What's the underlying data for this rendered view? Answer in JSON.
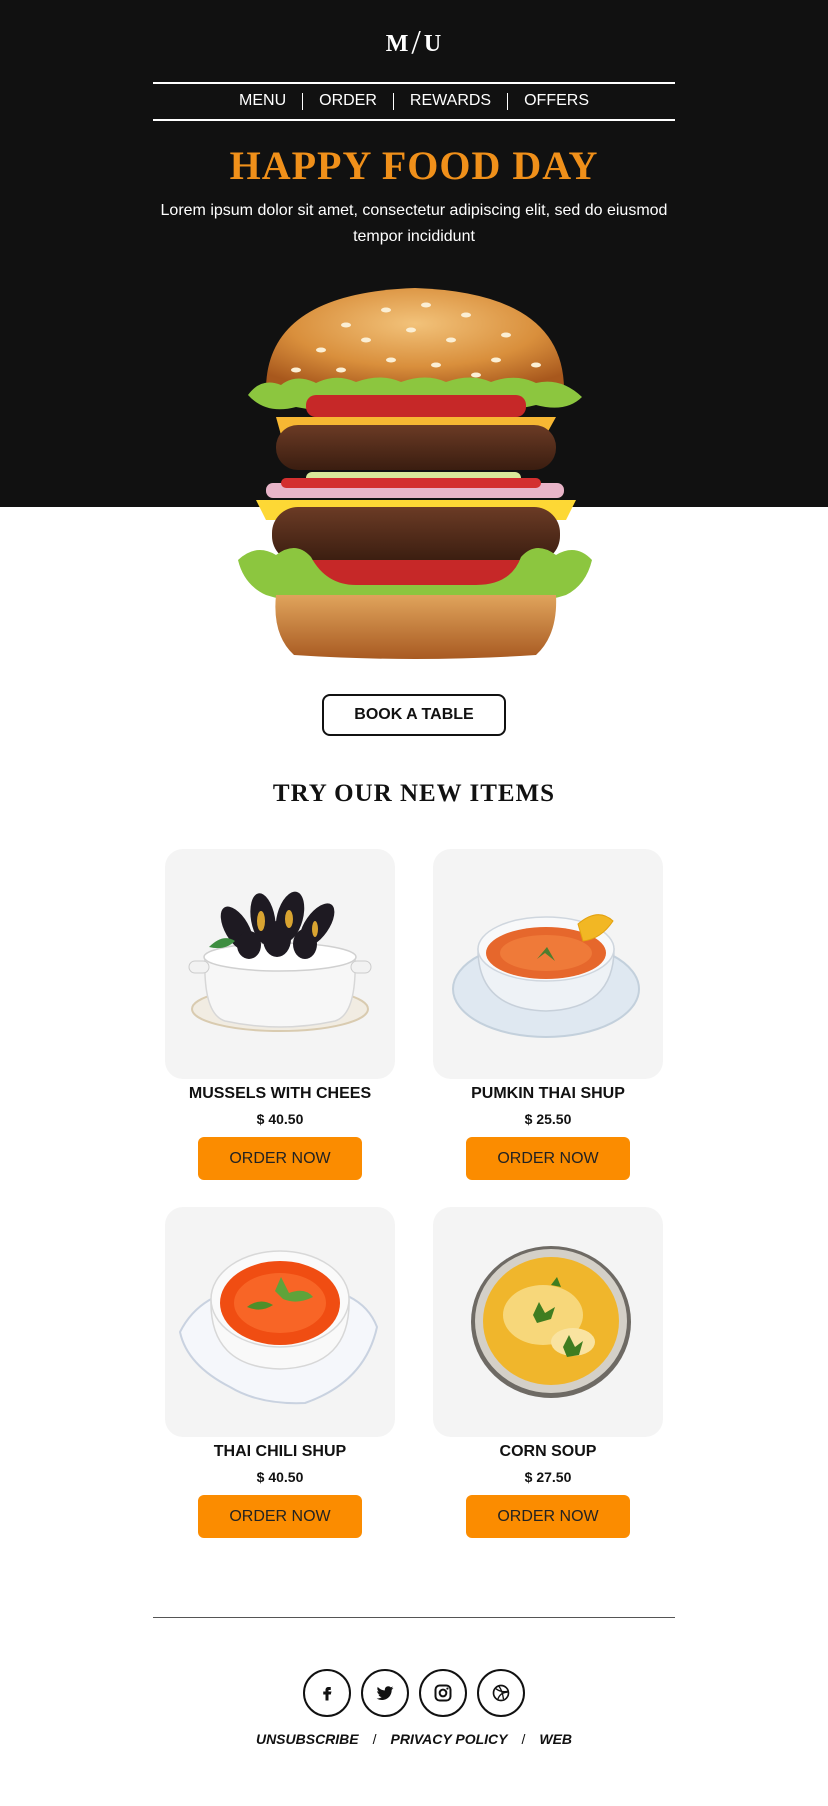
{
  "brand": {
    "logo_left": "M",
    "logo_slash": "/",
    "logo_right": "U"
  },
  "nav": {
    "items": [
      "MENU",
      "ORDER",
      "REWARDS",
      "OFFERS"
    ]
  },
  "hero": {
    "headline": "HAPPY FOOD DAY",
    "subtext": "Lorem ipsum dolor sit amet, consectetur adipiscing elit, sed do eiusmod tempor incididunt",
    "cta_label": "BOOK A TABLE"
  },
  "colors": {
    "hero_bg": "#111111",
    "accent": "#f0901a",
    "button": "#fb8c00",
    "card_bg": "#f4f4f4"
  },
  "new_items": {
    "title": "TRY OUR NEW ITEMS",
    "items": [
      {
        "name": "MUSSELS WITH CHEES",
        "price": "$ 40.50",
        "order_label": "ORDER NOW",
        "image": "mussels-pot"
      },
      {
        "name": "PUMKIN THAI SHUP",
        "price": "$ 25.50",
        "order_label": "ORDER NOW",
        "image": "pumpkin-soup-bowl"
      },
      {
        "name": "THAI CHILI SHUP",
        "price": "$ 40.50",
        "order_label": "ORDER NOW",
        "image": "chili-soup-bowl"
      },
      {
        "name": "CORN SOUP",
        "price": "$ 27.50",
        "order_label": "ORDER NOW",
        "image": "corn-soup-bowl"
      }
    ]
  },
  "footer": {
    "socials": [
      "facebook-icon",
      "twitter-icon",
      "instagram-icon",
      "dribbble-icon"
    ],
    "links": [
      "UNSUBSCRIBE",
      "PRIVACY POLICY",
      "WEB"
    ],
    "separator": "/"
  }
}
